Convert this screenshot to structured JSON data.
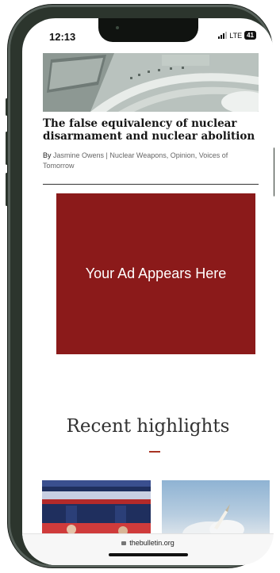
{
  "status_bar": {
    "time": "12:13",
    "network": "LTE",
    "battery": "41"
  },
  "article": {
    "title": "The false equivalency of nuclear disarmament and nuclear abolition",
    "by_prefix": "By",
    "byline": "Jasmine Owens | Nuclear Weapons, Opinion, Voices of Tomorrow"
  },
  "ad": {
    "text": "Your Ad Appears Here"
  },
  "recent": {
    "title": "Recent highlights"
  },
  "browser": {
    "url": "thebulletin.org"
  },
  "colors": {
    "ad_background": "#8b1a1a",
    "accent_rule": "#a83323",
    "phone_frame": "#2c352d"
  }
}
